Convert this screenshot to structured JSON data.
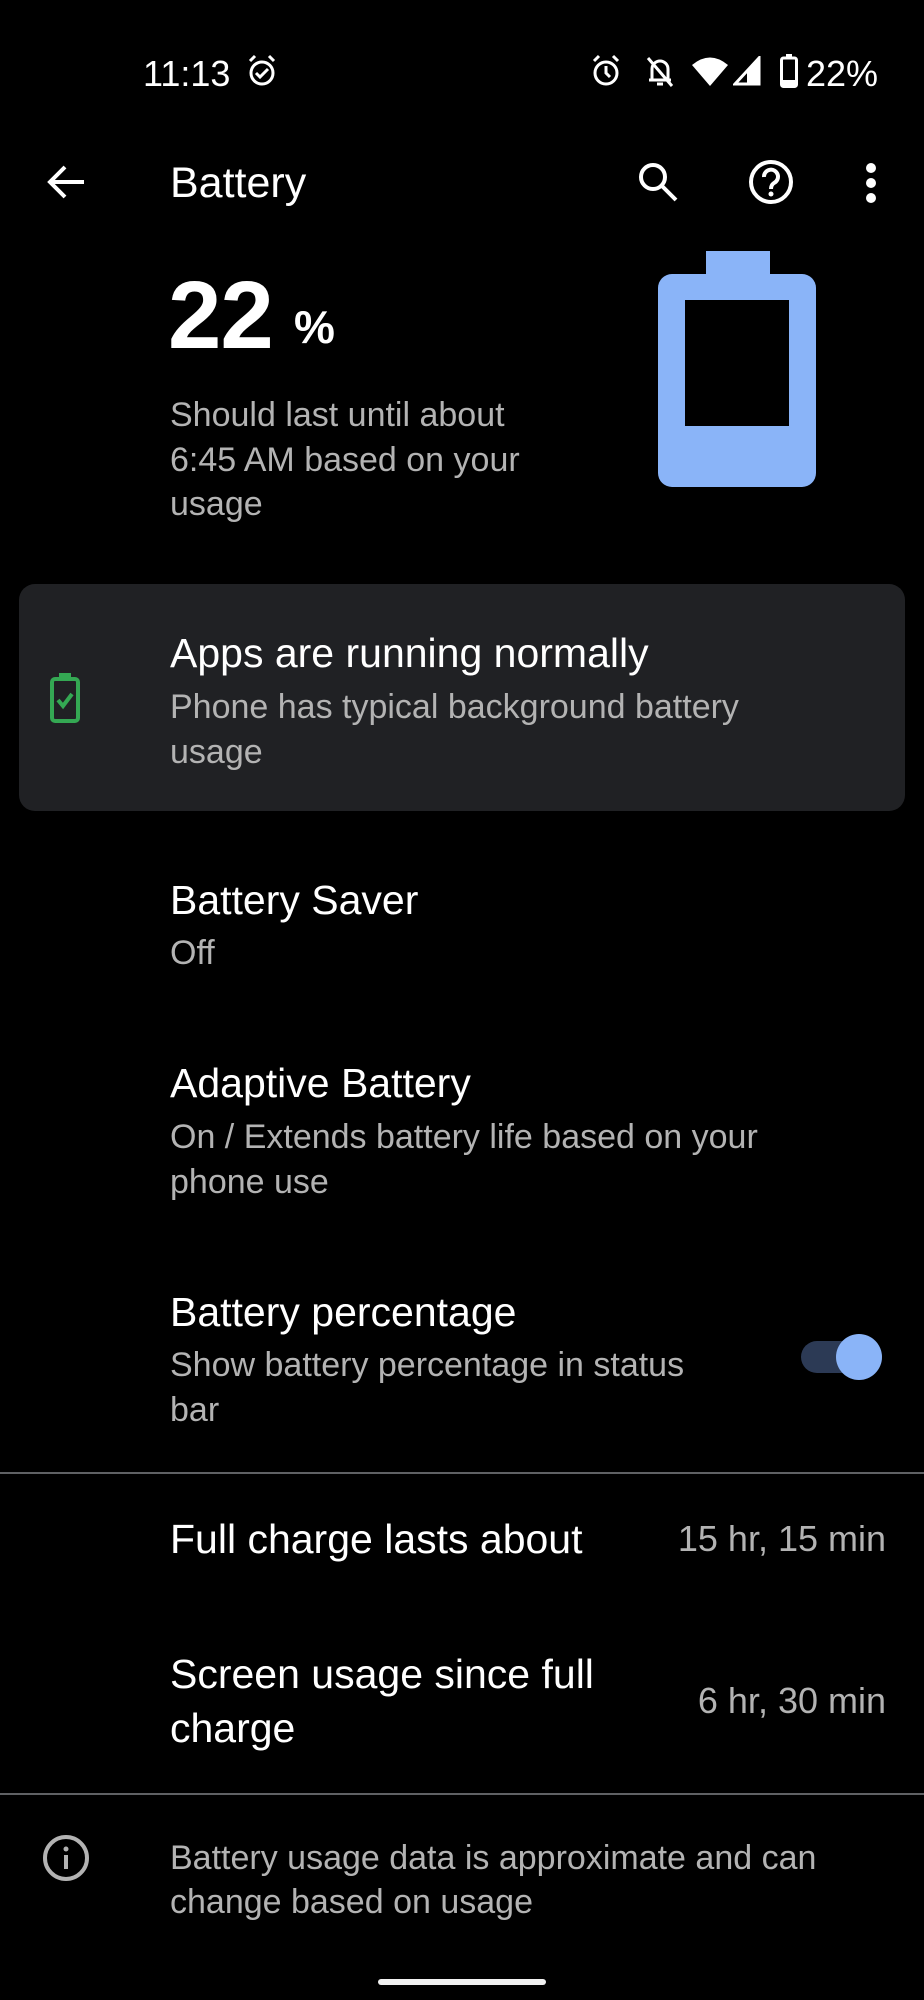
{
  "status_bar": {
    "time": "11:13",
    "left_icons": [
      "alarm-check-icon"
    ],
    "right_icons": [
      "alarm-icon",
      "notifications-off-icon",
      "wifi-icon",
      "cellular-signal-icon",
      "battery-icon"
    ],
    "battery_percent": "22%"
  },
  "toolbar": {
    "title": "Battery",
    "back_icon": "arrow-back-icon",
    "actions": [
      "search-icon",
      "help-icon",
      "more-vert-icon"
    ]
  },
  "battery_header": {
    "level_value": "22",
    "level_unit": "%",
    "level_fraction": 0.22,
    "estimate_line1": "Should last until about",
    "estimate_line2": "6:45 AM based on your",
    "estimate_line3": "usage",
    "icon_color": "#8ab4f8"
  },
  "tip_card": {
    "title": "Apps are running normally",
    "summary_line1": "Phone has typical background battery",
    "summary_line2": "usage",
    "icon": "battery-check-icon",
    "icon_color": "#34a853"
  },
  "settings": [
    {
      "title": "Battery Saver",
      "summary_lines": [
        "Off"
      ]
    },
    {
      "title": "Adaptive Battery",
      "summary_lines": [
        "On / Extends battery life based on your",
        "phone use"
      ]
    },
    {
      "title": "Battery percentage",
      "summary_lines": [
        "Show battery percentage in status",
        "bar"
      ],
      "toggle_on": true
    }
  ],
  "stats": [
    {
      "label_lines": [
        "Full charge lasts about"
      ],
      "value": "15 hr, 15 min"
    },
    {
      "label_lines": [
        "Screen usage since full",
        "charge"
      ],
      "value": "6 hr, 30 min"
    }
  ],
  "footer": {
    "icon": "info-icon",
    "text_line1": "Battery usage data is approximate and can",
    "text_line2": "change based on usage"
  },
  "colors": {
    "accent": "#8ab4f8",
    "card_bg": "#202124",
    "secondary_text": "#b3b3b3",
    "success": "#34a853"
  }
}
